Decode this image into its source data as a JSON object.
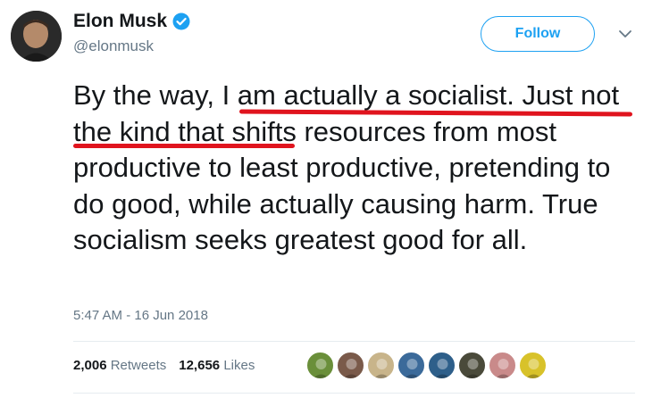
{
  "author": {
    "name": "Elon Musk",
    "handle": "@elonmusk",
    "verified": true
  },
  "follow_label": "Follow",
  "tweet": {
    "text_part1": "By the way, ",
    "text_underlined": "I am actually a socialist. Just not the kind that",
    "text_part2": " shifts resources from most productive to least productive, pretending to do good, while actually causing harm. True socialism seeks greatest good for all."
  },
  "timestamp": "5:47 AM - 16 Jun 2018",
  "stats": {
    "retweets_count": "2,006",
    "retweets_label": "Retweets",
    "likes_count": "12,656",
    "likes_label": "Likes"
  },
  "colors": {
    "accent": "#1da1f2",
    "underline": "#e0141e",
    "muted": "#657786"
  },
  "icons": [
    "verified-badge-icon",
    "chevron-down-icon"
  ],
  "liker_avatars": [
    {
      "color": "#6a8f3a"
    },
    {
      "color": "#7a5a4a"
    },
    {
      "color": "#c8b48a"
    },
    {
      "color": "#3b6a9a"
    },
    {
      "color": "#2e5f8a"
    },
    {
      "color": "#4a4a3a"
    },
    {
      "color": "#c98a8a"
    },
    {
      "color": "#d8c22a"
    }
  ]
}
